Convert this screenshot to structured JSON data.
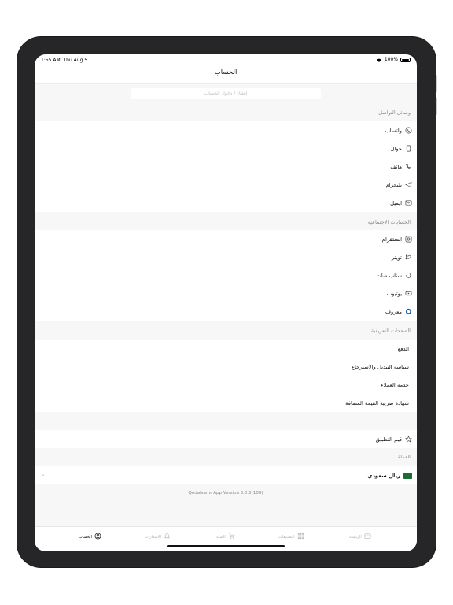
{
  "status": {
    "time": "1:55 AM",
    "date": "Thu Aug 5",
    "battery": "100%"
  },
  "header": {
    "title": "الحساب"
  },
  "search": {
    "placeholder": "إنشاء / دخول الحساب"
  },
  "contact": {
    "header": "وسائل التواصل",
    "items": [
      {
        "label": "واتساب",
        "icon": "whatsapp-icon"
      },
      {
        "label": "جوال",
        "icon": "mobile-icon"
      },
      {
        "label": "هاتف",
        "icon": "phone-icon"
      },
      {
        "label": "تليجرام",
        "icon": "telegram-icon"
      },
      {
        "label": "ايميل",
        "icon": "email-icon"
      }
    ]
  },
  "social": {
    "header": "الحسابات الاجتماعية",
    "items": [
      {
        "label": "انستقرام",
        "icon": "instagram-icon"
      },
      {
        "label": "تويتر",
        "icon": "twitter-icon"
      },
      {
        "label": "سناب شات",
        "icon": "snapchat-icon"
      },
      {
        "label": "يوتيوب",
        "icon": "youtube-icon"
      },
      {
        "label": "معروف",
        "icon": "maroof-icon"
      }
    ]
  },
  "pages": {
    "header": "الصفحات التعريفية",
    "items": [
      {
        "label": "الدفع"
      },
      {
        "label": "سياسه التبديل والاسترجاع"
      },
      {
        "label": "خدمة العملاء"
      },
      {
        "label": "شهادة ضريبة القيمة المضافة"
      }
    ]
  },
  "rate": {
    "label": "قيم التطبيق",
    "icon": "star-icon"
  },
  "currency": {
    "header": "العملة",
    "value": "ريال سعودي",
    "icon": "saudi-flag-icon"
  },
  "version": "Qodalsamr App Version 3.0.5(108)",
  "tabs": [
    {
      "label": "الحساب",
      "icon": "account-icon",
      "active": true
    },
    {
      "label": "الاشعارات",
      "icon": "bell-icon"
    },
    {
      "label": "السلة",
      "icon": "cart-icon"
    },
    {
      "label": "التصنيفات",
      "icon": "grid-icon"
    },
    {
      "label": "الرئيسة",
      "icon": "home-icon"
    }
  ]
}
